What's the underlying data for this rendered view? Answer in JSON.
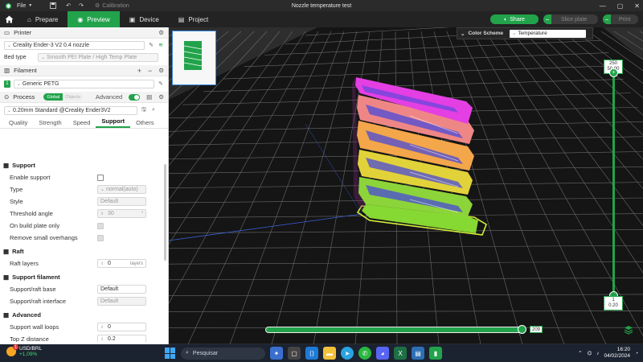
{
  "window": {
    "title": "Nozzle temperature test",
    "menu_file": "File",
    "calibration": "Calibration"
  },
  "nav": {
    "tabs": [
      {
        "label": "Prepare"
      },
      {
        "label": "Preview"
      },
      {
        "label": "Device"
      },
      {
        "label": "Project"
      }
    ],
    "share": "Share",
    "slice_plate": "Slice plate",
    "print": "Print"
  },
  "printer": {
    "section": "Printer",
    "name": "Creality Ender-3 V2 0.4 nozzle",
    "bed_type_label": "Bed type",
    "bed_type": "Smooth PEI Plate / High Temp Plate"
  },
  "filament": {
    "section": "Filament",
    "index": "1",
    "name": "Generic PETG"
  },
  "process": {
    "section": "Process",
    "global": "Global",
    "objects": "Objects",
    "advanced": "Advanced",
    "profile": "0.20mm Standard @Creality Ender3V2",
    "tabs": [
      "Quality",
      "Strength",
      "Speed",
      "Support",
      "Others"
    ]
  },
  "settings": {
    "support_group": "Support",
    "enable_support": "Enable support",
    "type_label": "Type",
    "type_value": "normal(auto)",
    "style_label": "Style",
    "style_value": "Default",
    "threshold_label": "Threshold angle",
    "threshold_value": "30",
    "on_build_plate": "On build plate only",
    "remove_overhangs": "Remove small overhangs",
    "raft_group": "Raft",
    "raft_layers_label": "Raft layers",
    "raft_layers_value": "0",
    "raft_layers_unit": "layers",
    "support_filament_group": "Support filament",
    "support_base_label": "Support/raft base",
    "support_base_value": "Default",
    "support_interface_label": "Support/raft interface",
    "support_interface_value": "Default",
    "advanced_group": "Advanced",
    "wall_loops_label": "Support wall loops",
    "wall_loops_value": "0",
    "top_z_label": "Top Z distance",
    "top_z_value": "0.2"
  },
  "viewport": {
    "color_scheme_label": "Color Scheme",
    "color_scheme_value": "Temperature",
    "layer_top": "250",
    "layer_top_z": "50.00",
    "layer_bottom": "1",
    "layer_bottom_z": "0.20",
    "move_value": "209"
  },
  "taskbar": {
    "ticker": "USD/BRL",
    "ticker_change": "+1,09%",
    "search_placeholder": "Pesquisar",
    "time": "16:20",
    "date": "04/02/2024",
    "notif_count": "1"
  },
  "colors": {
    "accent": "#22a34b",
    "magenta": "#e640e6",
    "salmon": "#f08a8a",
    "yellow": "#e8d13a",
    "lime": "#7fd63a"
  }
}
